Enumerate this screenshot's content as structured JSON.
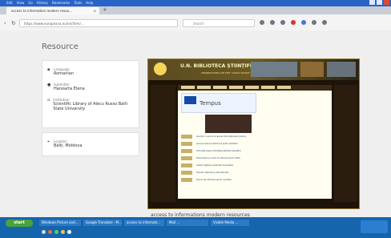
{
  "browser": {
    "menu": [
      "Edit",
      "View",
      "Go",
      "History",
      "Bookmarks",
      "Tools",
      "Help"
    ],
    "tab_title": "access to information modern resou...",
    "new_tab": "+",
    "close_tab": "×",
    "url": "https://www.europeana.eu/en/item/...",
    "search_placeholder": "Search"
  },
  "page": {
    "resource_title": "Resource",
    "fields": [
      {
        "label": "Language",
        "value": "Romanian"
      },
      {
        "label": "Submitter",
        "value": "Hanoarta Elena"
      },
      {
        "label": "Institution",
        "value": "Scientific Library of Alecu Russo Balti State University"
      },
      {
        "label": "Location",
        "value": "Bălți, Moldova"
      }
    ],
    "preview": {
      "library_name": "U.N. BIBLIOTECA ȘTIINȚIFICĂ",
      "library_subtitle": "UNIVERSITATEA DE STAT \"ALECU RUSSO\" BĂLȚI",
      "tempus": "Tempus",
      "caption": "access to informations modern resources"
    }
  },
  "taskbar": {
    "start": "start",
    "items": [
      "Windows Picture and...",
      "Google Translate - M...",
      "access to informati...",
      "Mail ...",
      "Visible Media ..."
    ]
  },
  "colors": {
    "taskbar_blue": "#1565ad",
    "start_green": "#4aa13d",
    "site_gold": "#f5f6bd"
  }
}
